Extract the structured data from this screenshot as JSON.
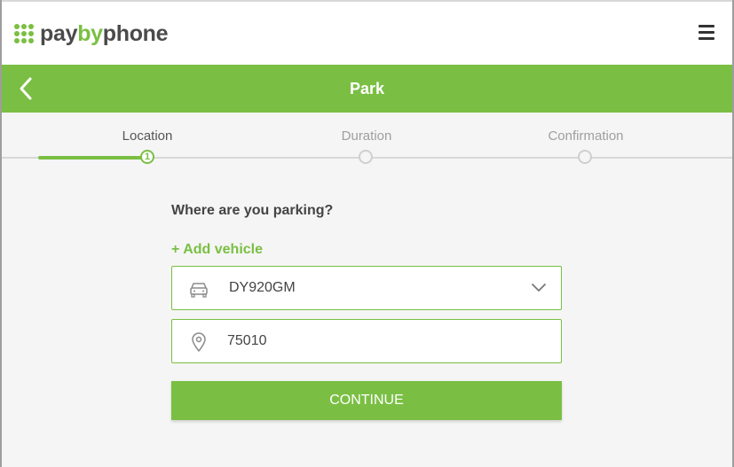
{
  "brand": {
    "logo_part1": "pay",
    "logo_part2": "by",
    "logo_part3": "phone",
    "accent_color": "#7abf43"
  },
  "header": {
    "menu_icon": "hamburger-menu-icon"
  },
  "titlebar": {
    "back_icon": "chevron-left-icon",
    "title": "Park"
  },
  "steps": [
    {
      "label": "Location",
      "number": "1",
      "state": "active"
    },
    {
      "label": "Duration",
      "number": "",
      "state": "pending"
    },
    {
      "label": "Confirmation",
      "number": "",
      "state": "pending"
    }
  ],
  "form": {
    "question": "Where are you parking?",
    "add_vehicle_label": "+ Add vehicle",
    "vehicle": {
      "icon": "car-icon",
      "selected": "DY920GM",
      "dropdown_icon": "chevron-down-icon"
    },
    "location": {
      "icon": "location-pin-icon",
      "value": "75010"
    },
    "continue_label": "CONTINUE"
  }
}
